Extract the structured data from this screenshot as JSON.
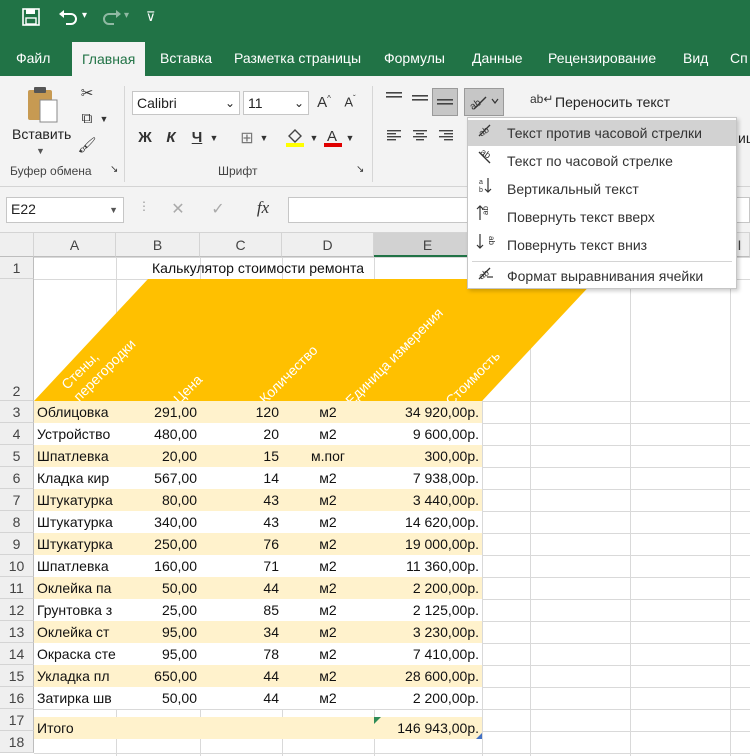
{
  "titlebar": {
    "save_icon": "save-icon",
    "undo_icon": "undo-icon",
    "redo_icon": "redo-icon",
    "customize_icon": "chevron-down-icon"
  },
  "tabs": [
    "Файл",
    "Главная",
    "Вставка",
    "Разметка страницы",
    "Формулы",
    "Данные",
    "Рецензирование",
    "Вид",
    "Сп"
  ],
  "active_tab": "Главная",
  "ribbon": {
    "paste_label": "Вставить",
    "clipboard_group": "Буфер обмена",
    "font_group": "Шрифт",
    "font_name": "Calibri",
    "font_size": "11",
    "bold": "Ж",
    "italic": "К",
    "underline": "Ч",
    "wrap_text": "Переносить текст",
    "merge_partial": "ице"
  },
  "formula_bar": {
    "name_box": "E22",
    "fx": "fx",
    "cancel": "✕",
    "enter": "✓"
  },
  "orientation_menu": {
    "items": [
      {
        "label": "Текст против часовой стрелки",
        "icon": "rotate-ccw-icon",
        "selected": true
      },
      {
        "label": "Текст по часовой стрелке",
        "icon": "rotate-cw-icon",
        "selected": false
      },
      {
        "label": "Вертикальный текст",
        "icon": "vertical-text-icon",
        "selected": false
      },
      {
        "label": "Повернуть текст вверх",
        "icon": "rotate-up-icon",
        "selected": false
      },
      {
        "label": "Повернуть текст вниз",
        "icon": "rotate-down-icon",
        "selected": false
      },
      {
        "label": "Формат выравнивания ячейки",
        "icon": "format-alignment-icon",
        "selected": false
      }
    ]
  },
  "sheet": {
    "columns": [
      "A",
      "B",
      "C",
      "D",
      "E",
      "",
      "",
      "",
      "I"
    ],
    "row_numbers": [
      "1",
      "2",
      "3",
      "4",
      "5",
      "6",
      "7",
      "8",
      "9",
      "10",
      "11",
      "12",
      "13",
      "14",
      "15",
      "16",
      "17",
      "18"
    ],
    "title": "Калькулятор стоимости ремонта",
    "headers": [
      "Стены, перегородки",
      "Цена",
      "Количество",
      "Единица измерения",
      "Стоимость"
    ],
    "rows": [
      [
        "Облицовка",
        "291,00",
        "120",
        "м2",
        "34 920,00р."
      ],
      [
        "Устройство",
        "480,00",
        "20",
        "м2",
        "9 600,00р."
      ],
      [
        "Шпатлевка",
        "20,00",
        "15",
        "м.пог",
        "300,00р."
      ],
      [
        "Кладка кир",
        "567,00",
        "14",
        "м2",
        "7 938,00р."
      ],
      [
        "Штукатурка",
        "80,00",
        "43",
        "м2",
        "3 440,00р."
      ],
      [
        "Штукатурка",
        "340,00",
        "43",
        "м2",
        "14 620,00р."
      ],
      [
        "Штукатурка",
        "250,00",
        "76",
        "м2",
        "19 000,00р."
      ],
      [
        "Шпатлевка",
        "160,00",
        "71",
        "м2",
        "11 360,00р."
      ],
      [
        "Оклейка па",
        "50,00",
        "44",
        "м2",
        "2 200,00р."
      ],
      [
        "Грунтовка з",
        "25,00",
        "85",
        "м2",
        "2 125,00р."
      ],
      [
        "Оклейка ст",
        "95,00",
        "34",
        "м2",
        "3 230,00р."
      ],
      [
        "Окраска сте",
        "95,00",
        "78",
        "м2",
        "7 410,00р."
      ],
      [
        "Укладка пл",
        "650,00",
        "44",
        "м2",
        "28 600,00р."
      ],
      [
        "Затирка шв",
        "50,00",
        "44",
        "м2",
        "2 200,00р."
      ]
    ],
    "total_label": "Итого",
    "total_value": "146 943,00р.",
    "colors": {
      "header_fill": "#ffc000",
      "band_fill": "#fff2cc",
      "accent": "#217346"
    }
  }
}
